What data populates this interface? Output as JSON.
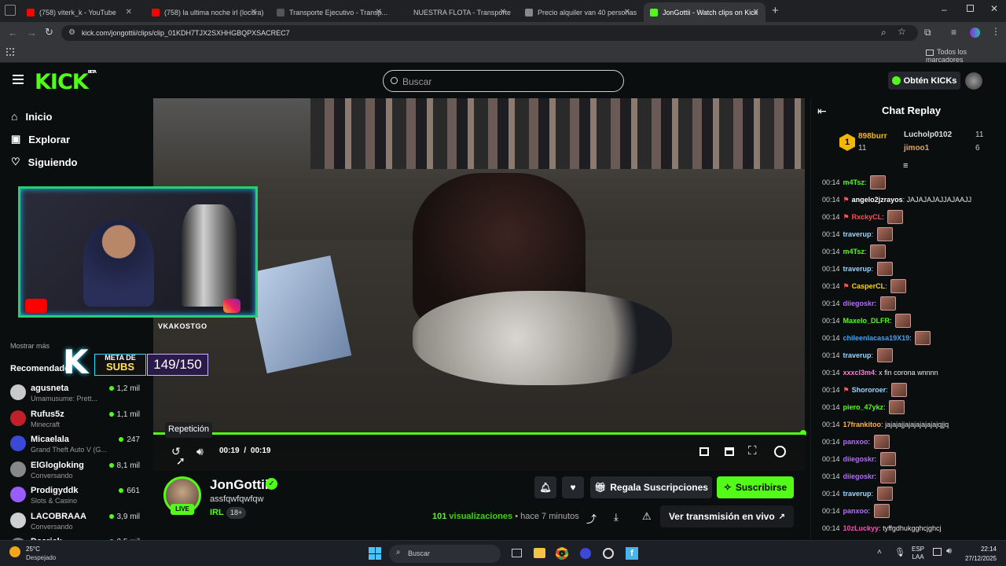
{
  "browser": {
    "tabs": [
      {
        "label": "(758) viterk_k - YouTube",
        "color": "#ff0000"
      },
      {
        "label": "(758) la ultima noche irl (locura)",
        "color": "#ff0000"
      },
      {
        "label": "Transporte Ejecutivo - Transp...",
        "color": "#555555"
      },
      {
        "label": "NUESTRA FLOTA - Transporte Ej...",
        "color": "#222222"
      },
      {
        "label": "Precio alquiler van 40 personas",
        "color": "#888888"
      },
      {
        "label": "JonGottii - Watch clips on Kick",
        "color": "#53fc18"
      }
    ],
    "url": "kick.com/jongottii/clips/clip_01KDH7TJX2SXHHGBQPXSACREC7",
    "bookmarks_label": "Todos los marcadores"
  },
  "header": {
    "logo": "KICK",
    "logo_badge": "BETA",
    "search_placeholder": "Buscar",
    "kicks_button": "Obtén KICKs"
  },
  "sidebar": {
    "nav": [
      {
        "label": "Inicio",
        "icon": "home-icon"
      },
      {
        "label": "Explorar",
        "icon": "compass-icon"
      },
      {
        "label": "Siguiendo",
        "icon": "heart-icon"
      }
    ],
    "show_more": "Mostrar más",
    "recommended_title": "Recomendado",
    "channels": [
      {
        "name": "agusneta",
        "game": "Umamusume: Prett...",
        "viewers": "1,2 mil",
        "color": "#c9c9c9"
      },
      {
        "name": "Rufus5z",
        "game": "Minecraft",
        "viewers": "1,1 mil",
        "color": "#c0202a"
      },
      {
        "name": "Micaelala",
        "game": "Grand Theft Auto V (G...",
        "viewers": "247",
        "color": "#3a4ad6"
      },
      {
        "name": "ElGlogloking",
        "game": "Conversando",
        "viewers": "8,1 mil",
        "color": "#888888"
      },
      {
        "name": "Prodigyddk",
        "game": "Slots & Casino",
        "viewers": "661",
        "color": "#9a5cff"
      },
      {
        "name": "LACOBRAAA",
        "game": "Conversando",
        "viewers": "3,9 mil",
        "color": "#d0d0d0"
      },
      {
        "name": "Daarick",
        "game": "",
        "viewers": "2,5 mil",
        "color": "#7a7a7a"
      }
    ]
  },
  "overlay": {
    "handle": "VKAKOSTGO",
    "goal_title_1": "META DE",
    "goal_title_2": "SUBS",
    "goal_value": "149/150"
  },
  "player": {
    "tooltip": "Repetición",
    "time_current": "00:19",
    "time_sep": "/",
    "time_total": "00:19",
    "progress": 1.0
  },
  "channel": {
    "name": "JonGottii",
    "clip_title": "assfqwfqwfqw",
    "category": "IRL",
    "badge": "18+",
    "live_label": "LIVE",
    "views": "101",
    "views_label": "visualizaciones",
    "dot": "•",
    "time_ago": "hace 7 minutos",
    "gift_button": "Regala Suscripciones",
    "subscribe_button": "Suscribirse",
    "watch_live_button": "Ver transmisión en vivo"
  },
  "chat": {
    "title": "Chat Replay",
    "leaderboard": [
      {
        "rank": "1",
        "name": "898burr",
        "count": "11"
      },
      {
        "name": "Lucholp0102",
        "count": "11"
      },
      {
        "name": "jimoo1",
        "count": "6"
      }
    ],
    "messages": [
      {
        "time": "00:14",
        "user": "m4Tsz",
        "color": "#53fc18",
        "text": "",
        "emote": true
      },
      {
        "time": "00:14",
        "user": "angelo2jzrayos",
        "color": "#ffffff",
        "text": "JAJAJAJAJJAJAAJJ",
        "emote": false,
        "badge": true
      },
      {
        "time": "00:14",
        "user": "RxckyCL",
        "color": "#ff4d4d",
        "text": "",
        "emote": true,
        "badge": true
      },
      {
        "time": "00:14",
        "user": "traverup",
        "color": "#9ad6ff",
        "text": "",
        "emote": true
      },
      {
        "time": "00:14",
        "user": "m4Tsz",
        "color": "#53fc18",
        "text": "",
        "emote": true
      },
      {
        "time": "00:14",
        "user": "traverup",
        "color": "#9ad6ff",
        "text": "",
        "emote": true
      },
      {
        "time": "00:14",
        "user": "CasperCL",
        "color": "#ffd700",
        "text": "",
        "emote": true,
        "badge": true
      },
      {
        "time": "00:14",
        "user": "diiegoskr",
        "color": "#b36bff",
        "text": "",
        "emote": true
      },
      {
        "time": "00:14",
        "user": "Maxelo_DLFR",
        "color": "#53fc18",
        "text": "",
        "emote": true
      },
      {
        "time": "00:14",
        "user": "chileenlacasa19X19",
        "color": "#3ba3ff",
        "text": "",
        "emote": true
      },
      {
        "time": "00:14",
        "user": "traverup",
        "color": "#9ad6ff",
        "text": "",
        "emote": true
      },
      {
        "time": "00:14",
        "user": "xxxcl3m4",
        "color": "#ff7ad9",
        "text": "x fin corona wnnnn",
        "emote": false
      },
      {
        "time": "00:14",
        "user": "Shororoer",
        "color": "#9ad6ff",
        "text": "",
        "emote": true,
        "badge": true
      },
      {
        "time": "00:14",
        "user": "piero_47ykz",
        "color": "#53fc18",
        "text": "",
        "emote": true
      },
      {
        "time": "00:14",
        "user": "17frankitoo",
        "color": "#ffb347",
        "text": "jajajajjajajajajajajqjjq",
        "emote": false
      },
      {
        "time": "00:14",
        "user": "panxoo",
        "color": "#b36bff",
        "text": "",
        "emote": true
      },
      {
        "time": "00:14",
        "user": "diiegoskr",
        "color": "#b36bff",
        "text": "",
        "emote": true
      },
      {
        "time": "00:14",
        "user": "diiegoskr",
        "color": "#b36bff",
        "text": "",
        "emote": true
      },
      {
        "time": "00:14",
        "user": "traverup",
        "color": "#9ad6ff",
        "text": "",
        "emote": true
      },
      {
        "time": "00:14",
        "user": "panxoo",
        "color": "#b36bff",
        "text": "",
        "emote": true
      },
      {
        "time": "00:14",
        "user": "10zLuckyy",
        "color": "#ff4db8",
        "text": "tyffgdhukgghcjghcj",
        "emote": false
      }
    ]
  },
  "taskbar": {
    "temp": "25°C",
    "weather": "Despejado",
    "search": "Buscar",
    "lang1": "ESP",
    "lang2": "LAA",
    "time": "22:14",
    "date": "27/12/2025"
  },
  "colors": {
    "kick_green": "#53fc18",
    "bg": "#0b0e0f"
  }
}
